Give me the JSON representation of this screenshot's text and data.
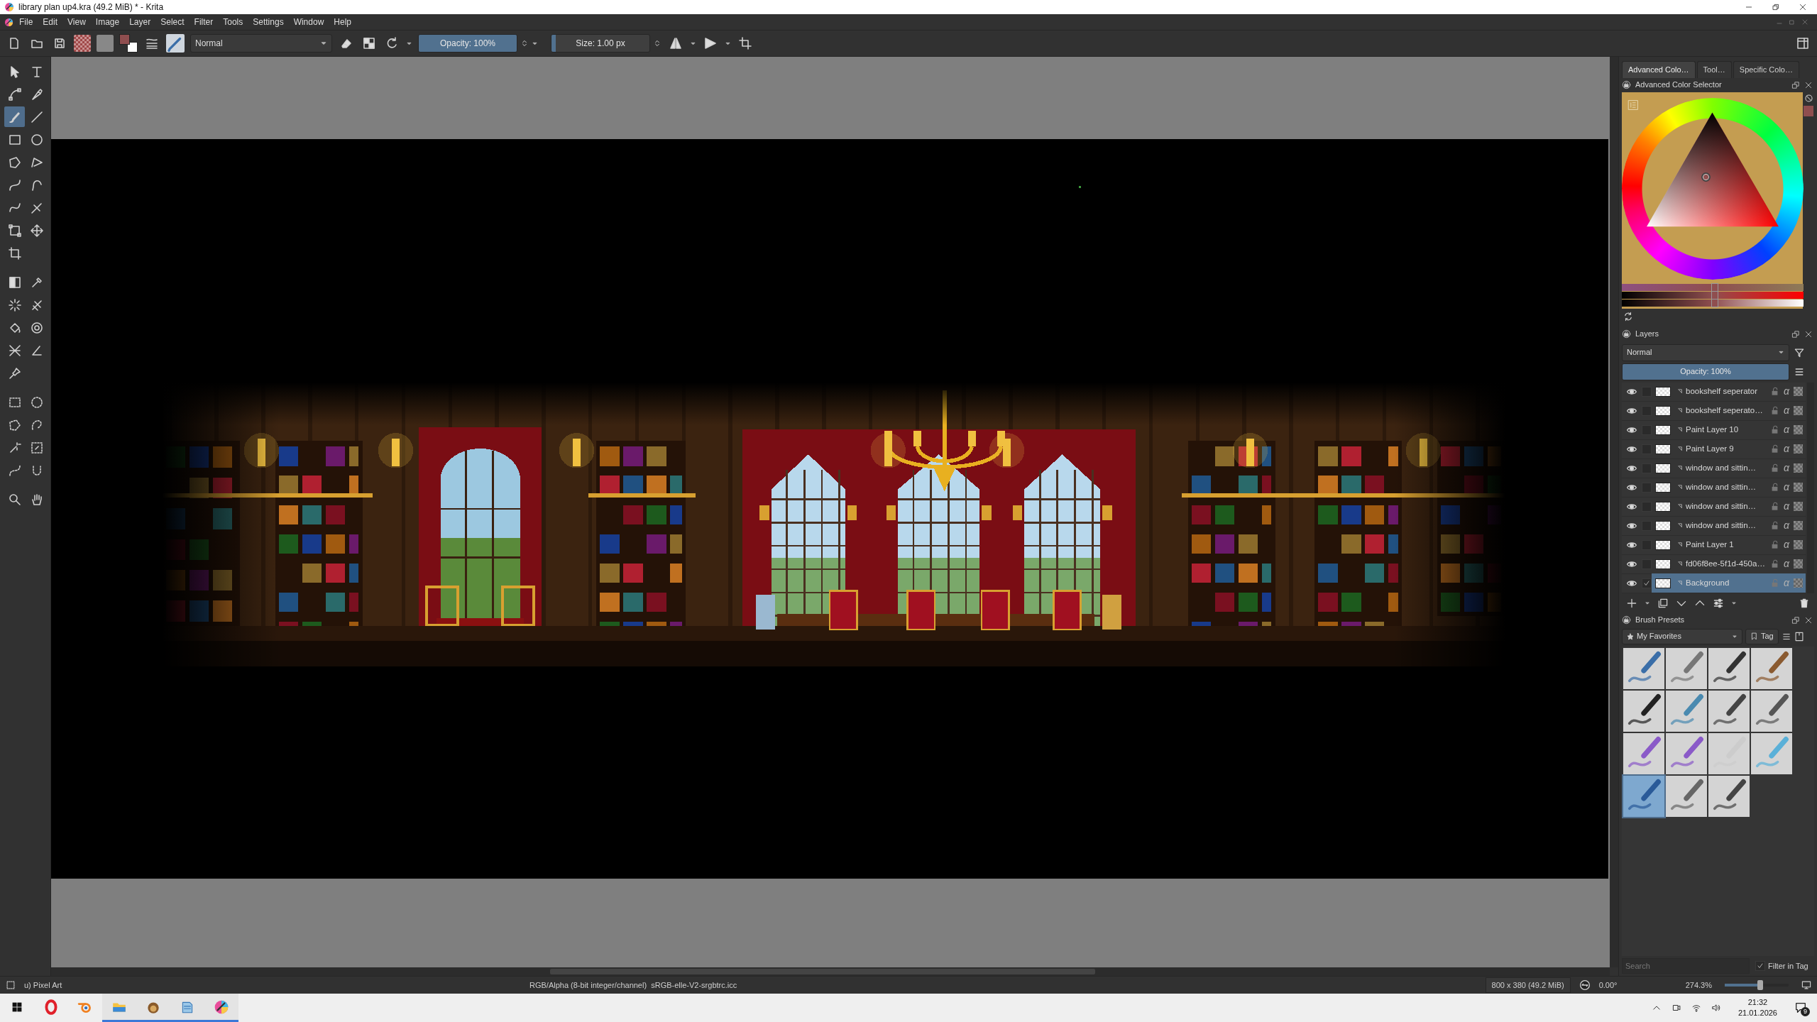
{
  "window": {
    "title": "library plan up4.kra (49.2 MiB) * - Krita"
  },
  "menu": [
    "File",
    "Edit",
    "View",
    "Image",
    "Layer",
    "Select",
    "Filter",
    "Tools",
    "Settings",
    "Window",
    "Help"
  ],
  "toolbar": {
    "blend_mode": "Normal",
    "opacity": {
      "label": "Opacity: 100%",
      "level": 1
    },
    "size": {
      "label": "Size: 1.00 px",
      "level": 0.04
    }
  },
  "toolbox": [
    {
      "tools": [
        {
          "selected": false
        },
        {
          "selected": false
        },
        {
          "selected": false
        },
        {
          "selected": false
        },
        {
          "selected": true
        },
        {
          "selected": false
        },
        {
          "selected": false
        },
        {
          "selected": false
        },
        {
          "selected": false
        },
        {
          "selected": false
        },
        {
          "selected": false
        },
        {
          "selected": false
        },
        {
          "selected": false
        },
        {
          "selected": false
        },
        {
          "selected": false
        },
        {
          "selected": false
        },
        {
          "selected": false
        }
      ]
    },
    {
      "tools": [
        {
          "selected": false
        },
        {
          "selected": false
        },
        {
          "selected": false
        },
        {
          "selected": false
        },
        {
          "selected": false
        },
        {
          "selected": false
        },
        {
          "selected": false
        },
        {
          "selected": false
        },
        {
          "selected": false
        }
      ]
    },
    {
      "tools": [
        {
          "selected": false
        },
        {
          "selected": false
        },
        {
          "selected": false
        },
        {
          "selected": false
        },
        {
          "selected": false
        },
        {
          "selected": false
        },
        {
          "selected": false
        },
        {
          "selected": false
        }
      ]
    },
    {
      "tools": [
        {
          "selected": false
        },
        {
          "selected": false
        }
      ]
    }
  ],
  "docker_tabs": [
    {
      "label": "Advanced Colo…",
      "selected": true
    },
    {
      "label": "Tool…",
      "selected": false
    },
    {
      "label": "Specific Colo…",
      "selected": false
    }
  ],
  "color_selector": {
    "title": "Advanced Color Selector",
    "sliders": [
      {
        "level": 0.51
      },
      {
        "level": 0.51
      },
      {
        "level": 0.51
      }
    ]
  },
  "layers": {
    "title": "Layers",
    "blend_mode": "Normal",
    "opacity": {
      "label": "Opacity:  100%",
      "level": 1
    },
    "items": [
      {
        "name": "bookshelf seperator",
        "alpha": "α",
        "visible": true,
        "checked": false,
        "selected": false
      },
      {
        "name": "bookshelf seperato…",
        "alpha": "α",
        "visible": true,
        "checked": false,
        "selected": false
      },
      {
        "name": "Paint Layer 10",
        "alpha": "α",
        "visible": true,
        "checked": false,
        "selected": false
      },
      {
        "name": "Paint Layer 9",
        "alpha": "α",
        "visible": true,
        "checked": false,
        "selected": false
      },
      {
        "name": "window and sittin…",
        "alpha": "α",
        "visible": true,
        "checked": false,
        "selected": false
      },
      {
        "name": "window and sittin…",
        "alpha": "α",
        "visible": true,
        "checked": false,
        "selected": false
      },
      {
        "name": "window and sittin…",
        "alpha": "α",
        "visible": true,
        "checked": false,
        "selected": false
      },
      {
        "name": "window and sittin…",
        "alpha": "α",
        "visible": true,
        "checked": false,
        "selected": false
      },
      {
        "name": "Paint Layer 1",
        "alpha": "α",
        "visible": true,
        "checked": false,
        "selected": false
      },
      {
        "name": "fd06f8ee-5f1d-450a…",
        "alpha": "α",
        "visible": true,
        "checked": false,
        "selected": false
      },
      {
        "name": "Background",
        "alpha": "α",
        "visible": true,
        "checked": true,
        "selected": true
      }
    ]
  },
  "brush_presets": {
    "title": "Brush Presets",
    "tag": "My Favorites",
    "tag_button": "Tag",
    "presets": [
      {
        "selected": false
      },
      {
        "selected": false
      },
      {
        "selected": false
      },
      {
        "selected": false
      },
      {
        "selected": false
      },
      {
        "selected": false
      },
      {
        "selected": false
      },
      {
        "selected": false
      },
      {
        "selected": false
      },
      {
        "selected": false
      },
      {
        "selected": false
      },
      {
        "selected": false
      },
      {
        "selected": true
      },
      {
        "selected": false
      },
      {
        "selected": false
      }
    ],
    "search": {
      "placeholder": "Search"
    },
    "filter_in_tag": {
      "label": "Filter in Tag",
      "checked": true
    }
  },
  "status_bar": {
    "brush": "u) Pixel Art",
    "color_space": "RGB/Alpha (8-bit integer/channel)  sRGB-elle-V2-srgbtrc.icc",
    "image_size": "800 x 380 (49.2 MiB)",
    "rotation": "0.00°",
    "zoom": "274.3%",
    "zoom_slider": {
      "level": 0.55
    }
  },
  "taskbar": {
    "apps": [
      {
        "running": false
      },
      {
        "running": false
      },
      {
        "running": true
      },
      {
        "running": true
      },
      {
        "running": true
      },
      {
        "running": true
      }
    ],
    "time": "21:32",
    "date": "21.01.2026",
    "notifications": "9"
  }
}
